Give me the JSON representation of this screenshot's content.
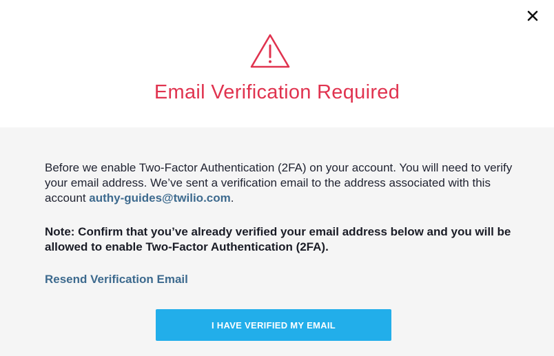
{
  "modal": {
    "title": "Email Verification Required",
    "close_icon": "close-icon",
    "header_icon": "warning-triangle-icon"
  },
  "body": {
    "intro_text": "Before we enable Two-Factor Authentication (2FA) on your account. You will need to verify your email address. We’ve sent a verification email to the address associated with this account ",
    "email": "authy-guides@twilio.com",
    "intro_end": ".",
    "note": "Note: Confirm that you’ve already verified your email address below and you will be allowed to enable Two-Factor Authentication (2FA).",
    "resend_label": "Resend Verification Email",
    "confirm_button_label": "I HAVE VERIFIED MY EMAIL"
  },
  "colors": {
    "title": "#e0334f",
    "link": "#3d6a8e",
    "button": "#22aeea",
    "body_background": "#f5f5f5"
  }
}
